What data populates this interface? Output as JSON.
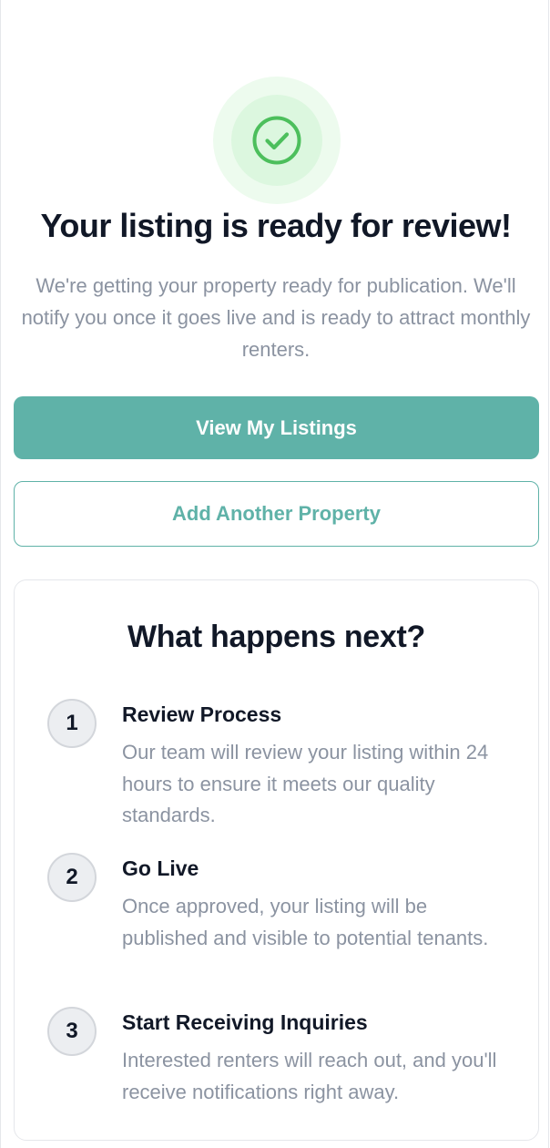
{
  "success": {
    "icon": "check-circle-icon",
    "accent_color": "#4cbf5c",
    "halo_color": "#edfbee"
  },
  "headline": "Your listing is ready for review!",
  "subtext": "We're getting your property ready for publication. We'll notify you once it goes live and is ready to attract monthly renters.",
  "actions": {
    "primary_label": "View My Listings",
    "secondary_label": "Add Another Property",
    "brand_color": "#5fb2a8"
  },
  "next_steps": {
    "title": "What happens next?",
    "steps": [
      {
        "number": "1",
        "title": "Review Process",
        "description": "Our team will review your listing within 24 hours to ensure it meets our quality standards."
      },
      {
        "number": "2",
        "title": "Go Live",
        "description": "Once approved, your listing will be published and visible to potential tenants."
      },
      {
        "number": "3",
        "title": "Start Receiving Inquiries",
        "description": "Interested renters will reach out, and you'll receive notifications right away."
      }
    ]
  }
}
